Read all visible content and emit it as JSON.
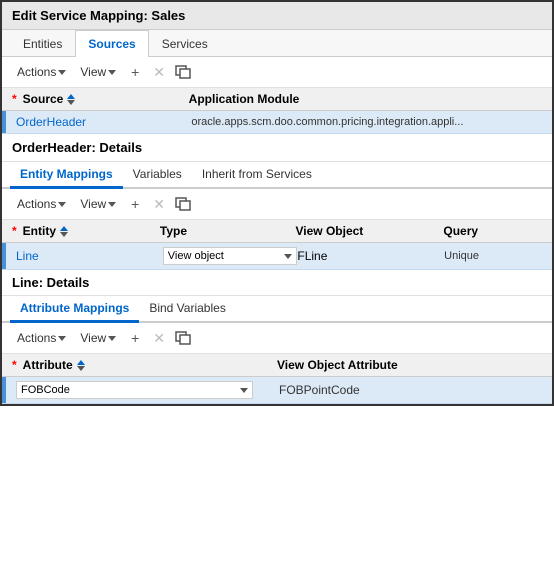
{
  "title": "Edit Service Mapping: Sales",
  "top_tabs": [
    {
      "label": "Entities",
      "active": false
    },
    {
      "label": "Sources",
      "active": true
    },
    {
      "label": "Services",
      "active": false
    }
  ],
  "toolbar": {
    "actions_label": "Actions",
    "view_label": "View",
    "add_icon": "+",
    "delete_icon": "✕",
    "detach_icon": "⊡"
  },
  "source_table": {
    "col1_header": "Source",
    "col2_header": "Application Module",
    "rows": [
      {
        "source": "OrderHeader",
        "app_module": "oracle.apps.scm.doo.common.pricing.integration.appli..."
      }
    ]
  },
  "detail_header": "OrderHeader: Details",
  "inner_tabs": [
    {
      "label": "Entity Mappings",
      "active": true
    },
    {
      "label": "Variables",
      "active": false
    },
    {
      "label": "Inherit from Services",
      "active": false
    }
  ],
  "inner_toolbar": {
    "actions_label": "Actions",
    "view_label": "View"
  },
  "entity_table": {
    "col1_header": "Entity",
    "col2_header": "Type",
    "col3_header": "View Object",
    "col4_header": "Query",
    "rows": [
      {
        "entity": "Line",
        "type": "View object",
        "view_object": "FLine",
        "query": "Unique"
      }
    ]
  },
  "line_detail_header": "Line: Details",
  "bottom_tabs": [
    {
      "label": "Attribute Mappings",
      "active": true
    },
    {
      "label": "Bind Variables",
      "active": false
    }
  ],
  "bottom_toolbar": {
    "actions_label": "Actions",
    "view_label": "View"
  },
  "attr_table": {
    "col1_header": "Attribute",
    "col2_header": "View Object Attribute",
    "rows": [
      {
        "attribute": "FOBCode",
        "view_attr": "FOBPointCode"
      }
    ]
  }
}
